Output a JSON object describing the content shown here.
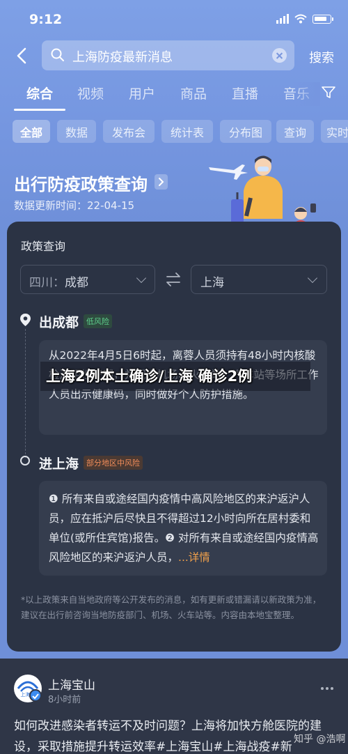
{
  "status_bar": {
    "time": "9:12"
  },
  "search": {
    "query": "上海防疫最新消息",
    "button": "搜索"
  },
  "tabs": [
    "综合",
    "视频",
    "用户",
    "商品",
    "直播",
    "音乐"
  ],
  "chips": [
    "全部",
    "数据",
    "发布会",
    "统计表",
    "分布图",
    "查询",
    "实时"
  ],
  "policy_card": {
    "title": "出行防疫政策查询",
    "update_time": "数据更新时间：22-04-15",
    "section_title": "政策查询",
    "from_province": "四川：",
    "from_city": "成都",
    "to_city": "上海",
    "depart": {
      "label": "出成都",
      "risk": "低风险",
      "text": "从2022年4月5日6时起，离蓉人员须持有48小时内核酸检测阴性证明，并配合机场、火车站、汽车站等场所工作人员出示健康码，同时做好个人防护措施。"
    },
    "arrive": {
      "label": "进上海",
      "risk": "部分地区中风险",
      "text": "❶ 所有来自或途经国内疫情中高风险地区的来沪返沪人员，应在抵沪后尽快且不得超过12小时向所在居村委和单位(或所住宾馆)报告。❷ 对所有来自或途经国内疫情高风险地区的来沪返沪人员，",
      "more": "...详情"
    },
    "disclaimer": "*以上政策来自当地政府等公开发布的消息，如有更新或错漏请以新政策为准，建议在出行前咨询当地防疫部门、机场、火车站等。内容由本地宝整理。"
  },
  "overlay_caption": "上海2例本土确诊/上海 确诊2例",
  "post": {
    "author": "上海宝山",
    "time": "8小时前",
    "avatar_text": "上海宝",
    "text": "如何改进感染者转运不及时问题？上海将加快方舱医院的建设，采取措施提升转运效率#上海宝山#上海战疫#新",
    "watermark": "知乎 @浩啊"
  },
  "colors": {
    "accent_blue": "#7596e0",
    "card_dark": "#2b3344",
    "low_risk": "#5ed08d",
    "mid_risk": "#f08c5a",
    "link_orange": "#f0a04b"
  }
}
